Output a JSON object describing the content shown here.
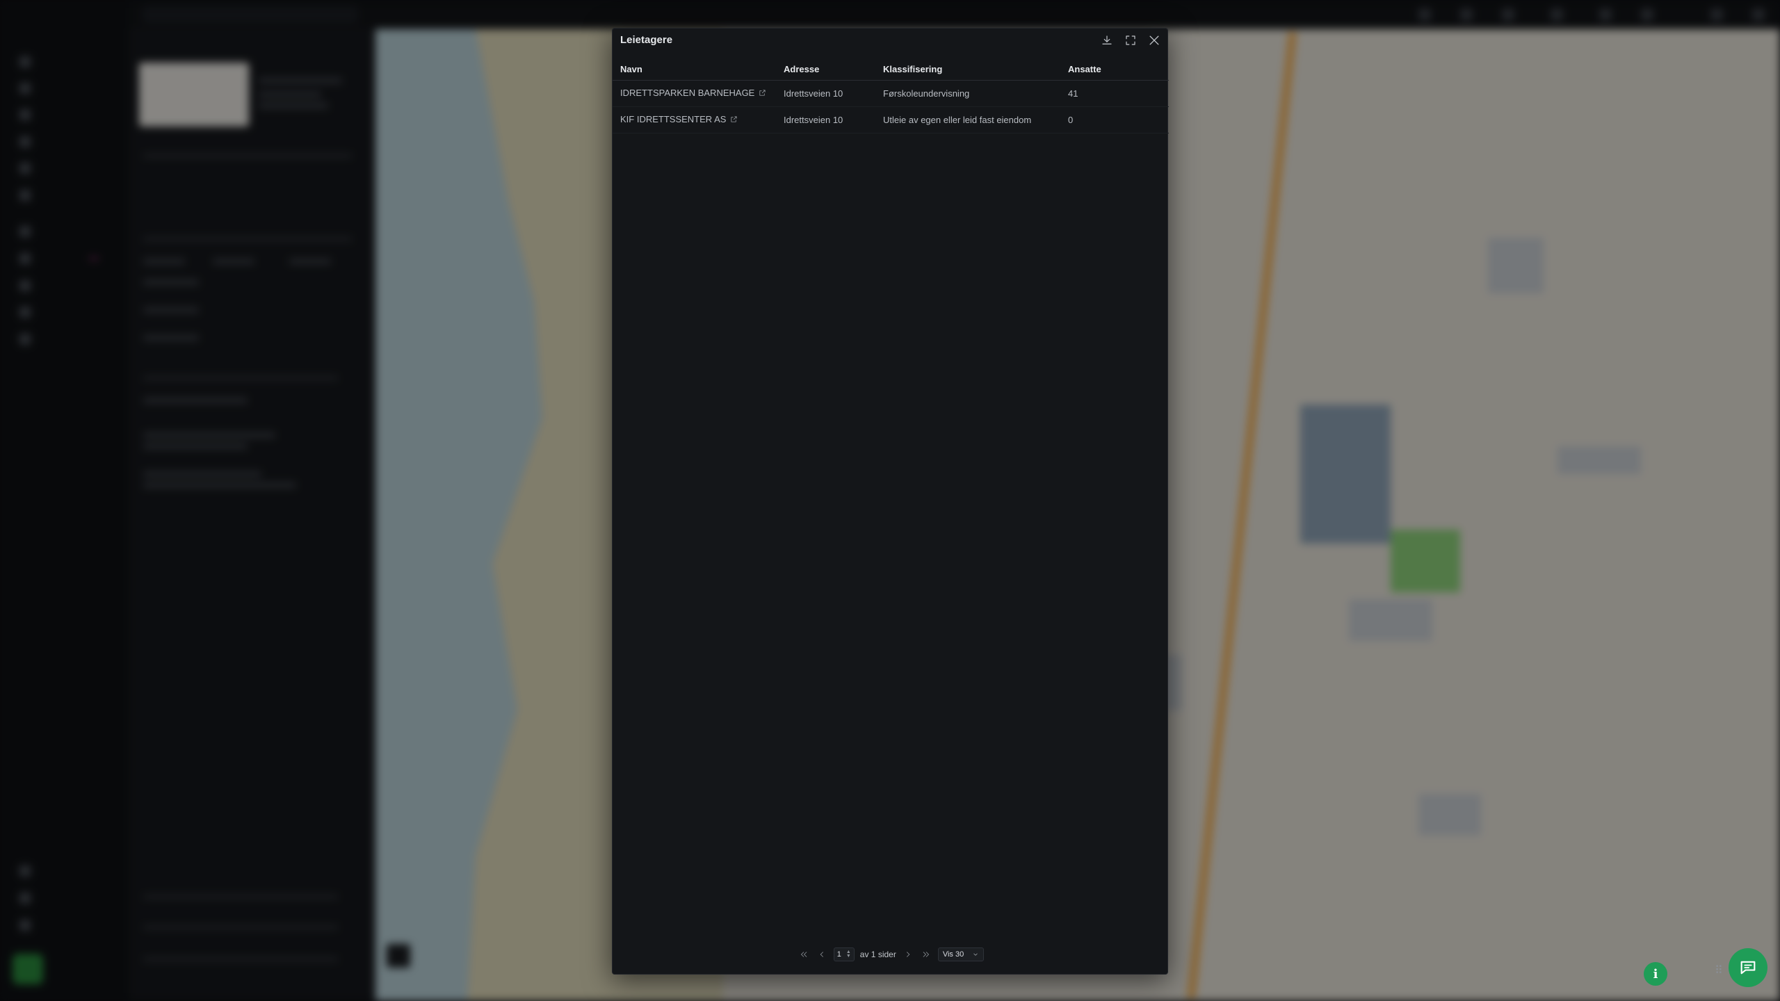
{
  "modal": {
    "title": "Leietagere",
    "columns": [
      "Navn",
      "Adresse",
      "Klassifisering",
      "Ansatte"
    ],
    "rows": [
      {
        "name": "IDRETTSPARKEN BARNEHAGE",
        "address": "Idrettsveien 10",
        "classification": "Førskoleundervisning",
        "employees": "41"
      },
      {
        "name": "KIF IDRETTSSENTER AS",
        "address": "Idrettsveien 10",
        "classification": "Utleie av egen eller leid fast eiendom",
        "employees": "0"
      }
    ],
    "pagination": {
      "current_page": "1",
      "of_pages_label": "av 1 sider",
      "page_size_label": "Vis 30"
    }
  },
  "icons": {
    "download": "download-icon",
    "fullscreen": "fullscreen-icon",
    "close": "close-icon",
    "external_link": "external-link-icon",
    "info": "info-icon",
    "chat": "chat-icon"
  },
  "colors": {
    "modal_bg": "#141619",
    "fab_green": "#1f9d57",
    "app_bg": "#0d0f12"
  }
}
